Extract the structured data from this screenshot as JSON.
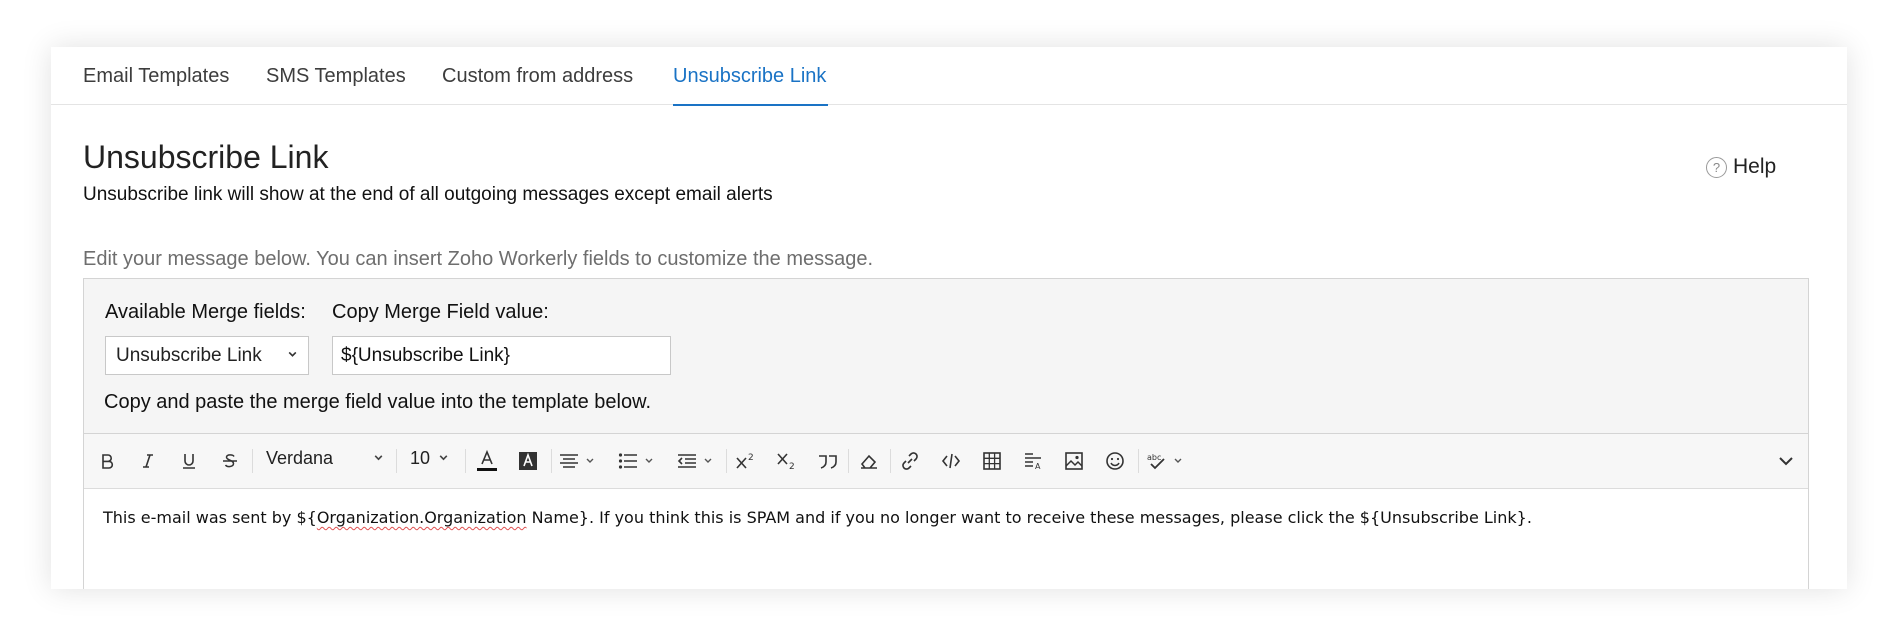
{
  "tabs": [
    {
      "label": "Email Templates"
    },
    {
      "label": "SMS Templates"
    },
    {
      "label": "Custom from address"
    },
    {
      "label": "Unsubscribe Link",
      "active": true
    }
  ],
  "header": {
    "title": "Unsubscribe Link",
    "subtitle": "Unsubscribe link will show at the end of all outgoing messages except email alerts",
    "help_label": "Help",
    "help_icon": "?"
  },
  "instruction": "Edit your message below. You can insert Zoho Workerly fields to customize the message.",
  "merge": {
    "available_label": "Available Merge fields:",
    "copy_label": "Copy Merge Field value:",
    "selected_field": "Unsubscribe Link",
    "field_value": "${Unsubscribe Link}",
    "note": "Copy and paste the merge field value into the template below."
  },
  "toolbar": {
    "font_family": "Verdana",
    "font_size": "10",
    "buttons": [
      "bold-icon",
      "italic-icon",
      "underline-icon",
      "strikethrough-icon",
      "font-color-icon",
      "highlight-color-icon",
      "align-icon",
      "list-icon",
      "indent-icon",
      "superscript-icon",
      "subscript-icon",
      "blockquote-icon",
      "clear-format-icon",
      "link-icon",
      "code-icon",
      "table-icon",
      "text-direction-icon",
      "image-icon",
      "emoji-icon",
      "spellcheck-icon",
      "expand-toolbar-icon"
    ]
  },
  "editor": {
    "text_before": "This e-mail was sent by ${",
    "misspelled": "Organization.Organization",
    "text_after": " Name}. If you think this is SPAM and if you no longer want to receive these messages, please click the ${Unsubscribe Link}."
  },
  "colors": {
    "accent": "#1a73c5",
    "spell_error": "#e05050"
  }
}
